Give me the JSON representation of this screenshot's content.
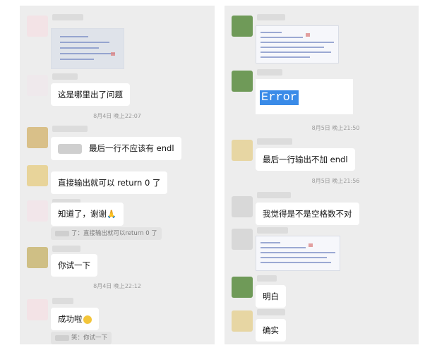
{
  "left": {
    "messages": [
      {
        "text": "这是哪里出了问题"
      },
      {
        "text": "最后一行不应该有 endl"
      },
      {
        "text": "直接输出就可以 return 0 了"
      },
      {
        "text": "知道了，谢谢"
      },
      {
        "text": "你试一下"
      },
      {
        "text": "成功啦"
      }
    ],
    "timestamps": [
      "8月4日 晚上22:07",
      "8月4日 晚上22:12"
    ],
    "quotes": [
      "了：直接输出就可以return 0 了",
      "笑：你试一下"
    ]
  },
  "right": {
    "error_label": "Error",
    "messages": [
      {
        "text": "最后一行输出不加 endl"
      },
      {
        "text": "我觉得是不是空格数不对"
      },
      {
        "text": "明白"
      },
      {
        "text": "确实"
      }
    ],
    "timestamps": [
      "8月5日 晚上21:50",
      "8月5日 晚上21:56"
    ]
  },
  "colors": {
    "panel_bg": "#ededed",
    "bubble_bg": "#ffffff",
    "selection_blue": "#3a8be8",
    "timestamp_grey": "#9a9a9a"
  },
  "icons": {
    "thumbs": "folded-hands-emoji",
    "smile": "smile-emoji"
  }
}
